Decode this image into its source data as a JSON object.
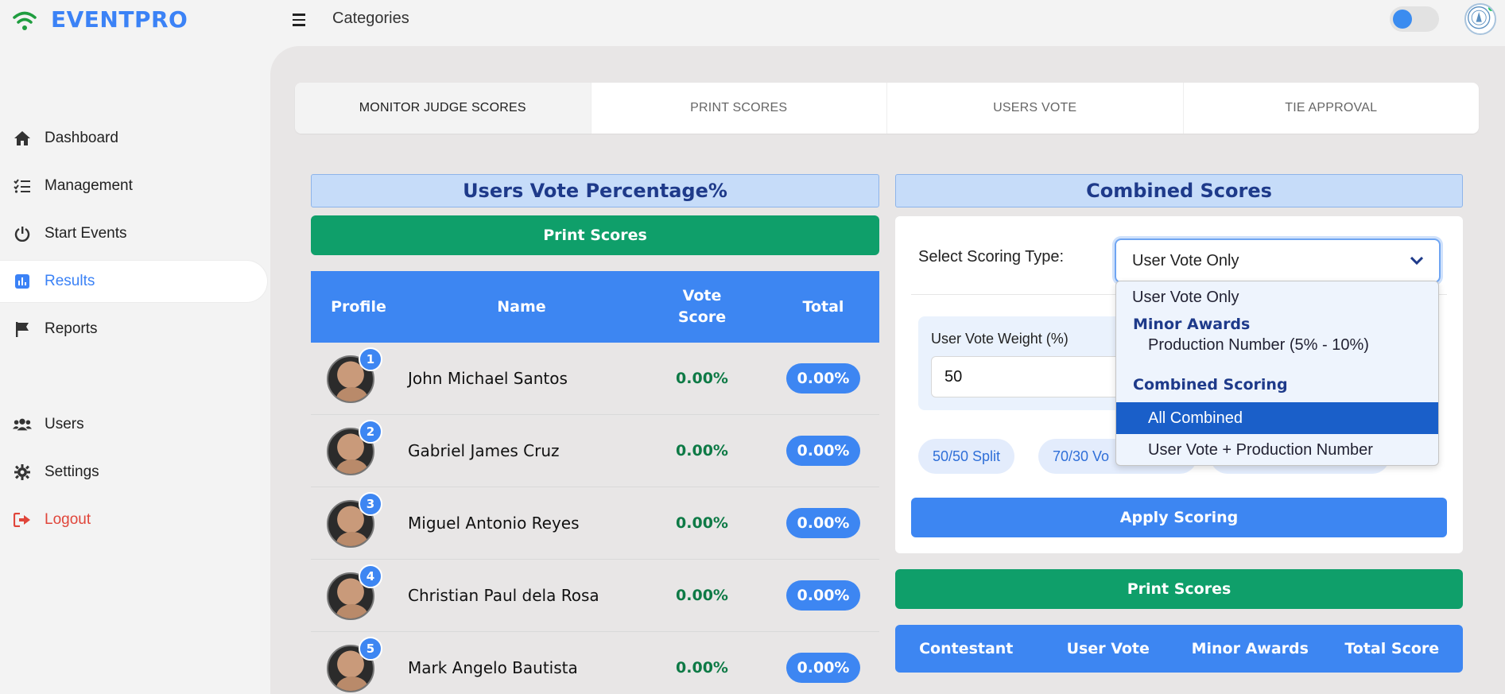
{
  "brand": {
    "name": "EVENTPRO"
  },
  "topbar": {
    "title": "Categories"
  },
  "sidebar": {
    "items": [
      {
        "label": "Dashboard",
        "icon": "home-icon"
      },
      {
        "label": "Management",
        "icon": "checklist-icon"
      },
      {
        "label": "Start Events",
        "icon": "power-icon"
      },
      {
        "label": "Results",
        "icon": "bar-chart-icon",
        "active": true
      },
      {
        "label": "Reports",
        "icon": "flag-icon"
      },
      {
        "label": "Users",
        "icon": "users-icon"
      },
      {
        "label": "Settings",
        "icon": "gear-icon"
      },
      {
        "label": "Logout",
        "icon": "logout-icon"
      }
    ]
  },
  "tabs": [
    {
      "label": "MONITOR JUDGE SCORES",
      "active": true
    },
    {
      "label": "PRINT SCORES"
    },
    {
      "label": "USERS VOTE"
    },
    {
      "label": "TIE APPROVAL"
    }
  ],
  "left_panel": {
    "title": "Users Vote Percentage%",
    "print_label": "Print Scores",
    "columns": {
      "profile": "Profile",
      "name": "Name",
      "vote_line1": "Vote",
      "vote_line2": "Score",
      "total": "Total"
    },
    "rows": [
      {
        "rank": "1",
        "name": "John Michael Santos",
        "vote": "0.00%",
        "total": "0.00%"
      },
      {
        "rank": "2",
        "name": "Gabriel James Cruz",
        "vote": "0.00%",
        "total": "0.00%"
      },
      {
        "rank": "3",
        "name": "Miguel Antonio Reyes",
        "vote": "0.00%",
        "total": "0.00%"
      },
      {
        "rank": "4",
        "name": "Christian Paul dela Rosa",
        "vote": "0.00%",
        "total": "0.00%"
      },
      {
        "rank": "5",
        "name": "Mark Angelo Bautista",
        "vote": "0.00%",
        "total": "0.00%"
      }
    ]
  },
  "right_panel": {
    "title": "Combined Scores",
    "select_label": "Select Scoring Type:",
    "select_value": "User Vote Only",
    "weight_label": "User Vote Weight (%)",
    "weight_value": "50",
    "preset_1": "50/50 Split",
    "preset_2": "70/30 Vo",
    "apply_label": "Apply Scoring",
    "print_label": "Print Scores",
    "columns": [
      "Contestant",
      "User Vote",
      "Minor Awards",
      "Total Score"
    ]
  },
  "dropdown": {
    "opt_user_vote": "User Vote Only",
    "group_minor": "Minor Awards",
    "opt_production": "Production Number (5% - 10%)",
    "group_combined": "Combined Scoring",
    "opt_all": "All Combined",
    "opt_vote_prod": "User Vote + Production Number"
  },
  "colors": {
    "accent": "#3d86f2",
    "green": "#0f9f6a",
    "header_bg": "#c6dcf9",
    "logout": "#e0453a"
  }
}
